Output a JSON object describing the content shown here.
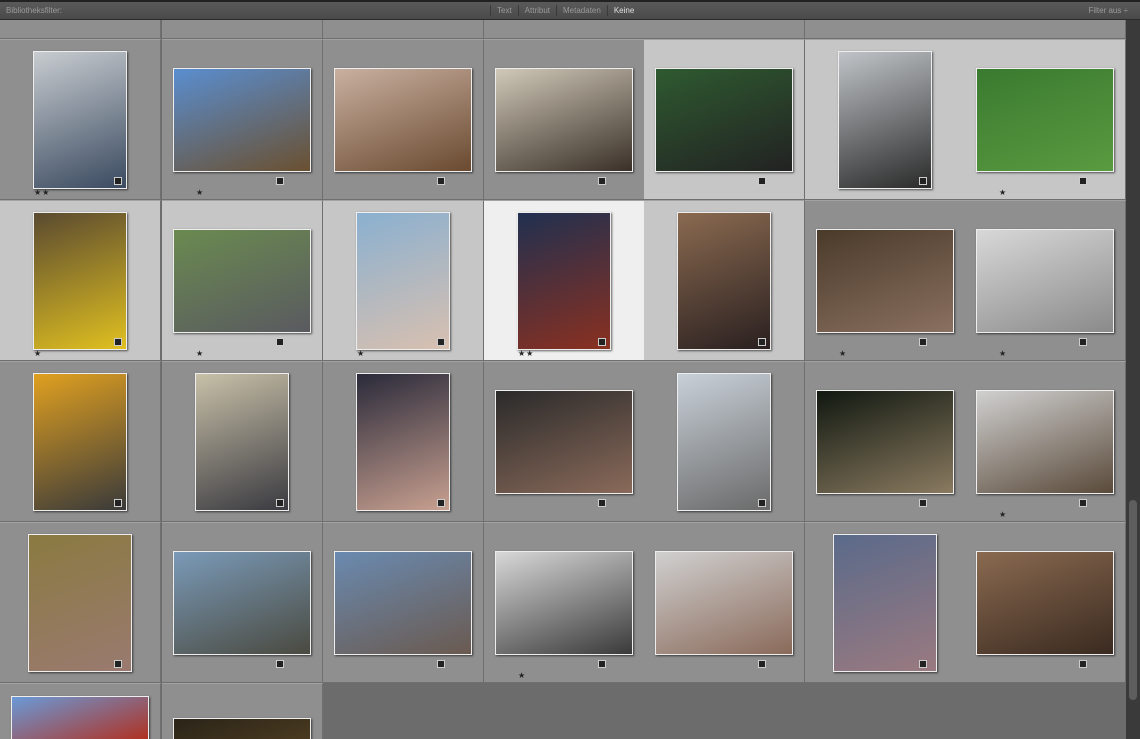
{
  "filterbar": {
    "label": "Bibliotheksfilter:",
    "tabs": [
      "Text",
      "Attribut",
      "Metadaten",
      "Keine"
    ],
    "active": "Keine",
    "filter_status": "Filter aus ÷"
  },
  "rows": [
    [
      {
        "o": "portrait",
        "c": [
          "#c8ccd0",
          "#3a4a60"
        ],
        "s": "★★",
        "st": ""
      },
      {
        "o": "landscape",
        "c": [
          "#5a8ed0",
          "#6a5030"
        ],
        "s": "★",
        "st": ""
      },
      {
        "o": "landscape",
        "c": [
          "#c9b0a0",
          "#6a4a30"
        ],
        "s": "",
        "st": ""
      },
      {
        "o": "landscape",
        "c": [
          "#d0c8b8",
          "#3a3028"
        ],
        "s": "",
        "st": ""
      },
      {
        "o": "landscape",
        "c": [
          "#2e5a30",
          "#222"
        ],
        "s": "",
        "st": "sel"
      },
      {
        "o": "portrait",
        "c": [
          "#c0c4c8",
          "#2a2a2a"
        ],
        "s": "",
        "st": "sel"
      },
      {
        "o": "landscape",
        "c": [
          "#3a7a30",
          "#5a9a40"
        ],
        "s": "★",
        "st": "sel"
      }
    ],
    [
      {
        "o": "portrait",
        "c": [
          "#5a4a30",
          "#e0c020"
        ],
        "s": "★",
        "st": "sel"
      },
      {
        "o": "landscape",
        "c": [
          "#6a8a50",
          "#5a5a60"
        ],
        "s": "★",
        "st": "sel"
      },
      {
        "o": "portrait",
        "c": [
          "#8ab0d0",
          "#d8c0b0"
        ],
        "s": "★",
        "st": "sel"
      },
      {
        "o": "portrait",
        "c": [
          "#203050",
          "#8a3020"
        ],
        "s": "★★",
        "st": "primary"
      },
      {
        "o": "portrait",
        "c": [
          "#8a6a50",
          "#2a2020"
        ],
        "s": "",
        "st": "sel"
      },
      {
        "o": "landscape",
        "c": [
          "#4a3a2a",
          "#8a7060"
        ],
        "s": "★",
        "st": ""
      },
      {
        "o": "landscape",
        "c": [
          "#d8d8d8",
          "#8a8a8a"
        ],
        "s": "★",
        "st": ""
      }
    ],
    [
      {
        "o": "portrait",
        "c": [
          "#e0a020",
          "#3a3a3a"
        ],
        "s": "",
        "st": ""
      },
      {
        "o": "portrait",
        "c": [
          "#c8c0a8",
          "#3a3a40"
        ],
        "s": "",
        "st": ""
      },
      {
        "o": "portrait",
        "c": [
          "#2a2a3a",
          "#c8a090"
        ],
        "s": "",
        "st": ""
      },
      {
        "o": "landscape",
        "c": [
          "#2a2a2a",
          "#8a6a5a"
        ],
        "s": "",
        "st": ""
      },
      {
        "o": "portrait",
        "c": [
          "#c8d0d8",
          "#6a6a6a"
        ],
        "s": "",
        "st": ""
      },
      {
        "o": "landscape",
        "c": [
          "#101810",
          "#8a7a60"
        ],
        "s": "",
        "st": ""
      },
      {
        "o": "landscape",
        "c": [
          "#d0d0d0",
          "#5a4a3a"
        ],
        "s": "★",
        "st": ""
      }
    ],
    [
      {
        "o": "square",
        "c": [
          "#8a7a40",
          "#9a7a70"
        ],
        "s": "",
        "st": ""
      },
      {
        "o": "landscape",
        "c": [
          "#7a9ab8",
          "#4a4a40"
        ],
        "s": "",
        "st": ""
      },
      {
        "o": "landscape",
        "c": [
          "#6a8ab0",
          "#6a5a50"
        ],
        "s": "",
        "st": ""
      },
      {
        "o": "landscape",
        "c": [
          "#d8d8d8",
          "#3a3a3a"
        ],
        "s": "★",
        "st": ""
      },
      {
        "o": "landscape",
        "c": [
          "#d0d0d0",
          "#8a6a5a"
        ],
        "s": "",
        "st": ""
      },
      {
        "o": "square",
        "c": [
          "#5a6a8a",
          "#9a7a80"
        ],
        "s": "",
        "st": ""
      },
      {
        "o": "landscape",
        "c": [
          "#8a6a50",
          "#3a2a20"
        ],
        "s": "",
        "st": ""
      }
    ],
    [
      {
        "o": "landscape",
        "c": [
          "#6a9ad8",
          "#b03020"
        ],
        "s": "",
        "st": ""
      },
      {
        "o": "landscape",
        "c": [
          "#2a2418",
          "#4a3a20"
        ],
        "s": "",
        "st": ""
      }
    ]
  ]
}
